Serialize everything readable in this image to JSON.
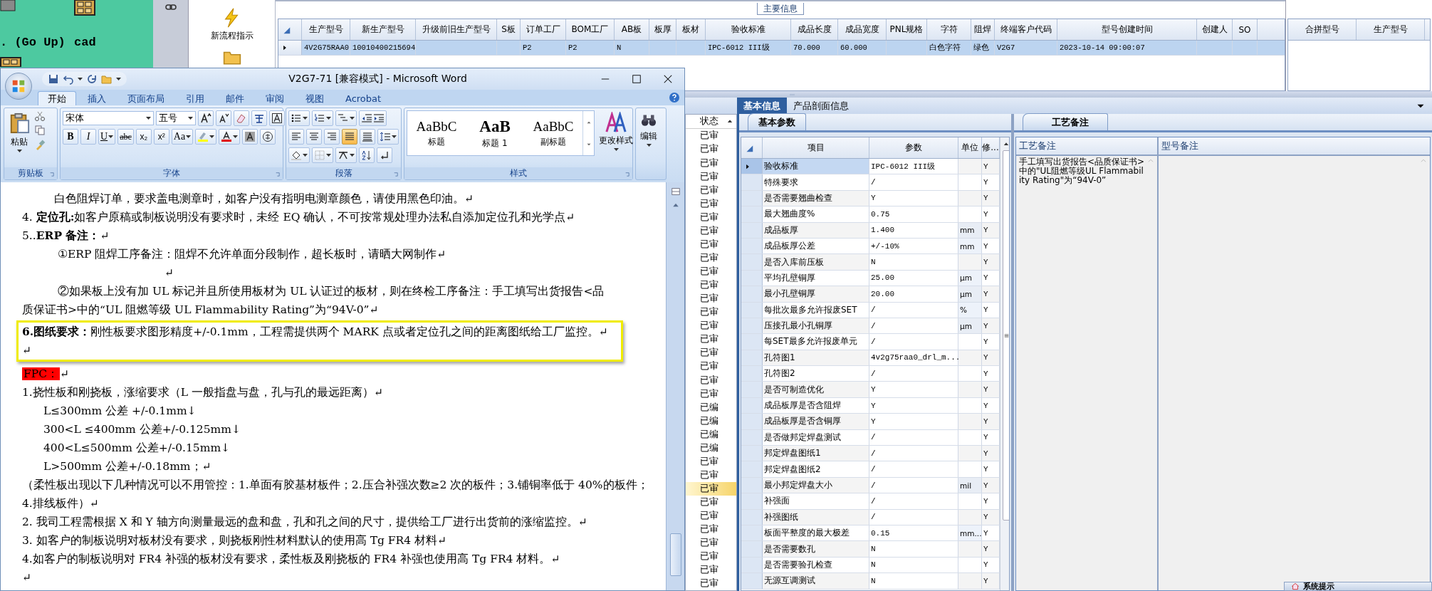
{
  "desktop": {
    "icons": [
      {
        "label": ". (Go Up)"
      },
      {
        "label": "cad"
      }
    ]
  },
  "app": {
    "flow_panel": {
      "label": "新流程指示"
    },
    "main_info": {
      "title": "主要信息",
      "row_selected": true,
      "columns": [
        {
          "label": "生产型号",
          "value": "4V2G75RAA0"
        },
        {
          "label": "新生产型号",
          "value": "10010400215694"
        },
        {
          "label": "升级前旧生产型号"
        },
        {
          "label": "S板"
        },
        {
          "label": "订单工厂",
          "value": "P2"
        },
        {
          "label": "BOM工厂",
          "value": "P2"
        },
        {
          "label": "AB板",
          "value": "N"
        },
        {
          "label": "板厚"
        },
        {
          "label": "板材"
        },
        {
          "label": "验收标准",
          "value": "IPC-6012 III级"
        },
        {
          "label": "成品长度",
          "value": "70.000"
        },
        {
          "label": "成品宽度",
          "value": "60.000"
        },
        {
          "label": "PNL规格"
        },
        {
          "label": "字符",
          "value": "白色字符"
        },
        {
          "label": "阻焊",
          "value": "绿色"
        },
        {
          "label": "终端客户代码",
          "value": "V2G7"
        },
        {
          "label": "型号创建时间",
          "value": "2023-10-14 09:00:07"
        },
        {
          "label": "创建人"
        },
        {
          "label": "SO"
        }
      ]
    },
    "merge_grid": {
      "columns": [
        "合拼型号",
        "生产型号"
      ]
    },
    "detail_tabs": [
      {
        "label": "基本信息",
        "selected": true
      },
      {
        "label": "产品剖面信息",
        "selected": false
      }
    ],
    "status_list": {
      "header": "状态",
      "items": [
        {
          "label": "已审",
          "selected": false
        },
        {
          "label": "已审",
          "selected": false
        },
        {
          "label": "已审",
          "selected": false
        },
        {
          "label": "已审",
          "selected": false
        },
        {
          "label": "已审",
          "selected": false
        },
        {
          "label": "已审",
          "selected": false
        },
        {
          "label": "已审",
          "selected": false
        },
        {
          "label": "已审",
          "selected": false
        },
        {
          "label": "已审",
          "selected": false
        },
        {
          "label": "已审",
          "selected": false
        },
        {
          "label": "已审",
          "selected": false
        },
        {
          "label": "已审",
          "selected": false
        },
        {
          "label": "已审",
          "selected": false
        },
        {
          "label": "已审",
          "selected": false
        },
        {
          "label": "已审",
          "selected": false
        },
        {
          "label": "已审",
          "selected": false
        },
        {
          "label": "已审",
          "selected": false
        },
        {
          "label": "已审",
          "selected": false
        },
        {
          "label": "已审",
          "selected": false
        },
        {
          "label": "已审",
          "selected": false
        },
        {
          "label": "已编",
          "selected": false
        },
        {
          "label": "已编",
          "selected": false
        },
        {
          "label": "已编",
          "selected": false
        },
        {
          "label": "已编",
          "selected": false
        },
        {
          "label": "已审",
          "selected": false
        },
        {
          "label": "已审",
          "selected": false
        },
        {
          "label": "已审",
          "selected": true
        },
        {
          "label": "已审",
          "selected": false
        },
        {
          "label": "已审",
          "selected": false
        },
        {
          "label": "已审",
          "selected": false
        },
        {
          "label": "已审",
          "selected": false
        },
        {
          "label": "已审",
          "selected": false
        },
        {
          "label": "已审",
          "selected": false
        },
        {
          "label": "已审",
          "selected": false
        }
      ]
    },
    "basic_params": {
      "tab": "基本参数",
      "columns": [
        "项目",
        "参数",
        "单位",
        "修..."
      ],
      "rows": [
        {
          "item": "验收标准",
          "value": "IPC-6012 III级",
          "modified": "Y",
          "selected": true
        },
        {
          "item": "特殊要求",
          "value": "/",
          "modified": "Y",
          "selected": false
        },
        {
          "item": "是否需要翘曲检查",
          "value": "Y",
          "modified": "Y",
          "selected": false
        },
        {
          "item": "最大翘曲度%",
          "value": "0.75",
          "modified": "Y",
          "selected": false
        },
        {
          "item": "成品板厚",
          "value": "1.400",
          "unit": "mm",
          "modified": "Y",
          "selected": false
        },
        {
          "item": "成品板厚公差",
          "value": "+/-10%",
          "unit": "mm",
          "modified": "Y",
          "selected": false
        },
        {
          "item": "是否入库前压板",
          "value": "N",
          "modified": "Y",
          "selected": false
        },
        {
          "item": "平均孔壁铜厚",
          "value": "25.00",
          "unit": "μm",
          "modified": "Y",
          "selected": false
        },
        {
          "item": "最小孔壁铜厚",
          "value": "20.00",
          "unit": "μm",
          "modified": "Y",
          "selected": false
        },
        {
          "item": "每批次最多允许报废SET",
          "value": "/",
          "unit": "%",
          "modified": "Y",
          "selected": false
        },
        {
          "item": "压接孔最小孔铜厚",
          "value": "/",
          "unit": "μm",
          "modified": "Y",
          "selected": false
        },
        {
          "item": "每SET最多允许报废单元",
          "value": "/",
          "modified": "Y",
          "selected": false
        },
        {
          "item": "孔符图1",
          "value": "4v2g75raa0_drl_m...",
          "modified": "Y",
          "selected": false
        },
        {
          "item": "孔符图2",
          "value": "/",
          "modified": "Y",
          "selected": false
        },
        {
          "item": "是否可制造优化",
          "value": "Y",
          "modified": "Y",
          "selected": false
        },
        {
          "item": "成品板厚是否含阻焊",
          "value": "Y",
          "modified": "Y",
          "selected": false
        },
        {
          "item": "成品板厚是否含铜厚",
          "value": "Y",
          "modified": "Y",
          "selected": false
        },
        {
          "item": "是否做邦定焊盘测试",
          "value": "/",
          "modified": "Y",
          "selected": false
        },
        {
          "item": "邦定焊盘图纸1",
          "value": "/",
          "modified": "Y",
          "selected": false
        },
        {
          "item": "邦定焊盘图纸2",
          "value": "/",
          "modified": "Y",
          "selected": false
        },
        {
          "item": "最小邦定焊盘大小",
          "value": "/",
          "unit": "mil",
          "modified": "Y",
          "selected": false
        },
        {
          "item": "补强面",
          "value": "/",
          "modified": "Y",
          "selected": false
        },
        {
          "item": "补强图纸",
          "value": "/",
          "modified": "Y",
          "selected": false
        },
        {
          "item": "板面平整度的最大极差",
          "value": "0.15",
          "unit": "mm...",
          "modified": "Y",
          "selected": false
        },
        {
          "item": "是否需要数孔",
          "value": "N",
          "modified": "Y",
          "selected": false
        },
        {
          "item": "是否需要验孔检查",
          "value": "N",
          "modified": "Y",
          "selected": false
        },
        {
          "item": "无源互调测试",
          "value": "N",
          "modified": "Y",
          "selected": false
        }
      ]
    },
    "process_notes": {
      "tab": "工艺备注",
      "columns": [
        {
          "label": "工艺备注",
          "text": "手工填写出货报告<品质保证书>中的\"UL阻燃等级UL Flammability Rating\"为“94V-0”"
        },
        {
          "label": "型号备注"
        }
      ]
    },
    "system_tip": {
      "label": "系统提示"
    }
  },
  "word": {
    "title": "V2G7-71 [兼容模式] - Microsoft Word",
    "tabs": [
      {
        "label": "开始",
        "selected": true
      },
      {
        "label": "插入",
        "selected": false
      },
      {
        "label": "页面布局",
        "selected": false
      },
      {
        "label": "引用",
        "selected": false
      },
      {
        "label": "邮件",
        "selected": false
      },
      {
        "label": "审阅",
        "selected": false
      },
      {
        "label": "视图",
        "selected": false
      },
      {
        "label": "Acrobat",
        "selected": false
      }
    ],
    "ribbon": {
      "clipboard": {
        "label": "剪贴板",
        "paste": "粘贴"
      },
      "font": {
        "label": "字体",
        "font_name": "宋体",
        "font_size": "五号",
        "buttons": [
          {
            "kind": "bold",
            "label": "B"
          },
          {
            "kind": "italic",
            "label": "I"
          },
          {
            "kind": "underline",
            "label": "U"
          },
          {
            "kind": "strike",
            "label": "abc"
          },
          {
            "kind": "sub",
            "label": "x₂"
          },
          {
            "kind": "sup",
            "label": "x²"
          },
          {
            "kind": "case",
            "label": "Aa"
          }
        ]
      },
      "paragraph": {
        "label": "段落",
        "align": [
          {
            "kind": "left",
            "selected": false
          },
          {
            "kind": "center",
            "selected": false
          },
          {
            "kind": "right",
            "selected": false
          },
          {
            "kind": "justify",
            "selected": true
          },
          {
            "kind": "distributed",
            "selected": false
          }
        ]
      },
      "styles": {
        "label": "样式",
        "gallery": [
          {
            "sample": "AaBbC",
            "name": "标题"
          },
          {
            "sample": "AaB",
            "name": "标题 1"
          },
          {
            "sample": "AaBbC",
            "name": "副标题"
          }
        ],
        "change": "更改样式"
      },
      "editing": {
        "label": "编辑"
      }
    },
    "document": [
      {
        "kind": "indent",
        "text": "白色阻焊订单，要求盖电测章时，如客户没有指明电测章颜色，请使用黑色印油。↵"
      },
      {
        "kind": "body",
        "text": "4.  **定位孔:**如客户原稿或制板说明没有要求时，未经 EQ 确认，不可按常规处理办法私自添加定位孔和光学点↵"
      },
      {
        "kind": "body",
        "text": "5..**ERP 备注：**↵"
      },
      {
        "kind": "deep",
        "text": "①ERP 阻焊工序备注：阻焊不允许单面分段制作，超长板时，请晒大网制作↵"
      },
      {
        "kind": "mid",
        "text": "↵"
      },
      {
        "kind": "deep",
        "text": "②如果板上没有加 UL 标记并且所使用板材为 UL 认证过的板材，则在终检工序备注：手工填写出货报告<品"
      },
      {
        "kind": "body",
        "text": "质保证书>中的“UL 阻燃等级 UL Flammability Rating”为“94V-0”↵"
      },
      {
        "kind": "frame",
        "paragraphs": [
          "**6.图纸要求：**刚性板要求图形精度+/-0.1mm，工程需提供两个 MARK 点或者定位孔之间的距离图纸给工厂监控。↵",
          "↵"
        ]
      },
      {
        "kind": "highlighted",
        "text": "FPC：",
        "end_mark": "↵"
      },
      {
        "kind": "body",
        "text": "1.挠性板和刚挠板，涨缩要求（L 一般指盘与盘，孔与孔的最远距离）↵"
      },
      {
        "kind": "list",
        "text": "L≤300mm 公差 +/-0.1mm↓"
      },
      {
        "kind": "list",
        "text": "300<L ≤400mm 公差+/-0.125mm↓"
      },
      {
        "kind": "list",
        "text": "400<L≤500mm 公差+/-0.15mm↓"
      },
      {
        "kind": "list",
        "text": "L>500mm 公差+/-0.18mm；↵"
      },
      {
        "kind": "body",
        "text": "（柔性板出现以下几种情况可以不用管控：1.单面有胶基材板件；2.压合补强次数≥2 次的板件；3.铺铜率低于 40%的板件；4.排线板件）↵"
      },
      {
        "kind": "body",
        "text": "2.    我司工程需根据 X 和 Y 轴方向测量最远的盘和盘，孔和孔之间的尺寸，提供给工厂进行出货前的涨缩监控。↵"
      },
      {
        "kind": "body",
        "text": "3. 如客户的制板说明对板材没有要求，则挠板刚性材料默认的使用高 Tg FR4 材料↵"
      },
      {
        "kind": "body",
        "text": " 4.如客户的制板说明对 FR4 补强的板材没有要求，柔性板及刚挠板的 FR4 补强也使用高 Tg FR4 材料。↵"
      },
      {
        "kind": "body",
        "text": "↵"
      }
    ]
  }
}
